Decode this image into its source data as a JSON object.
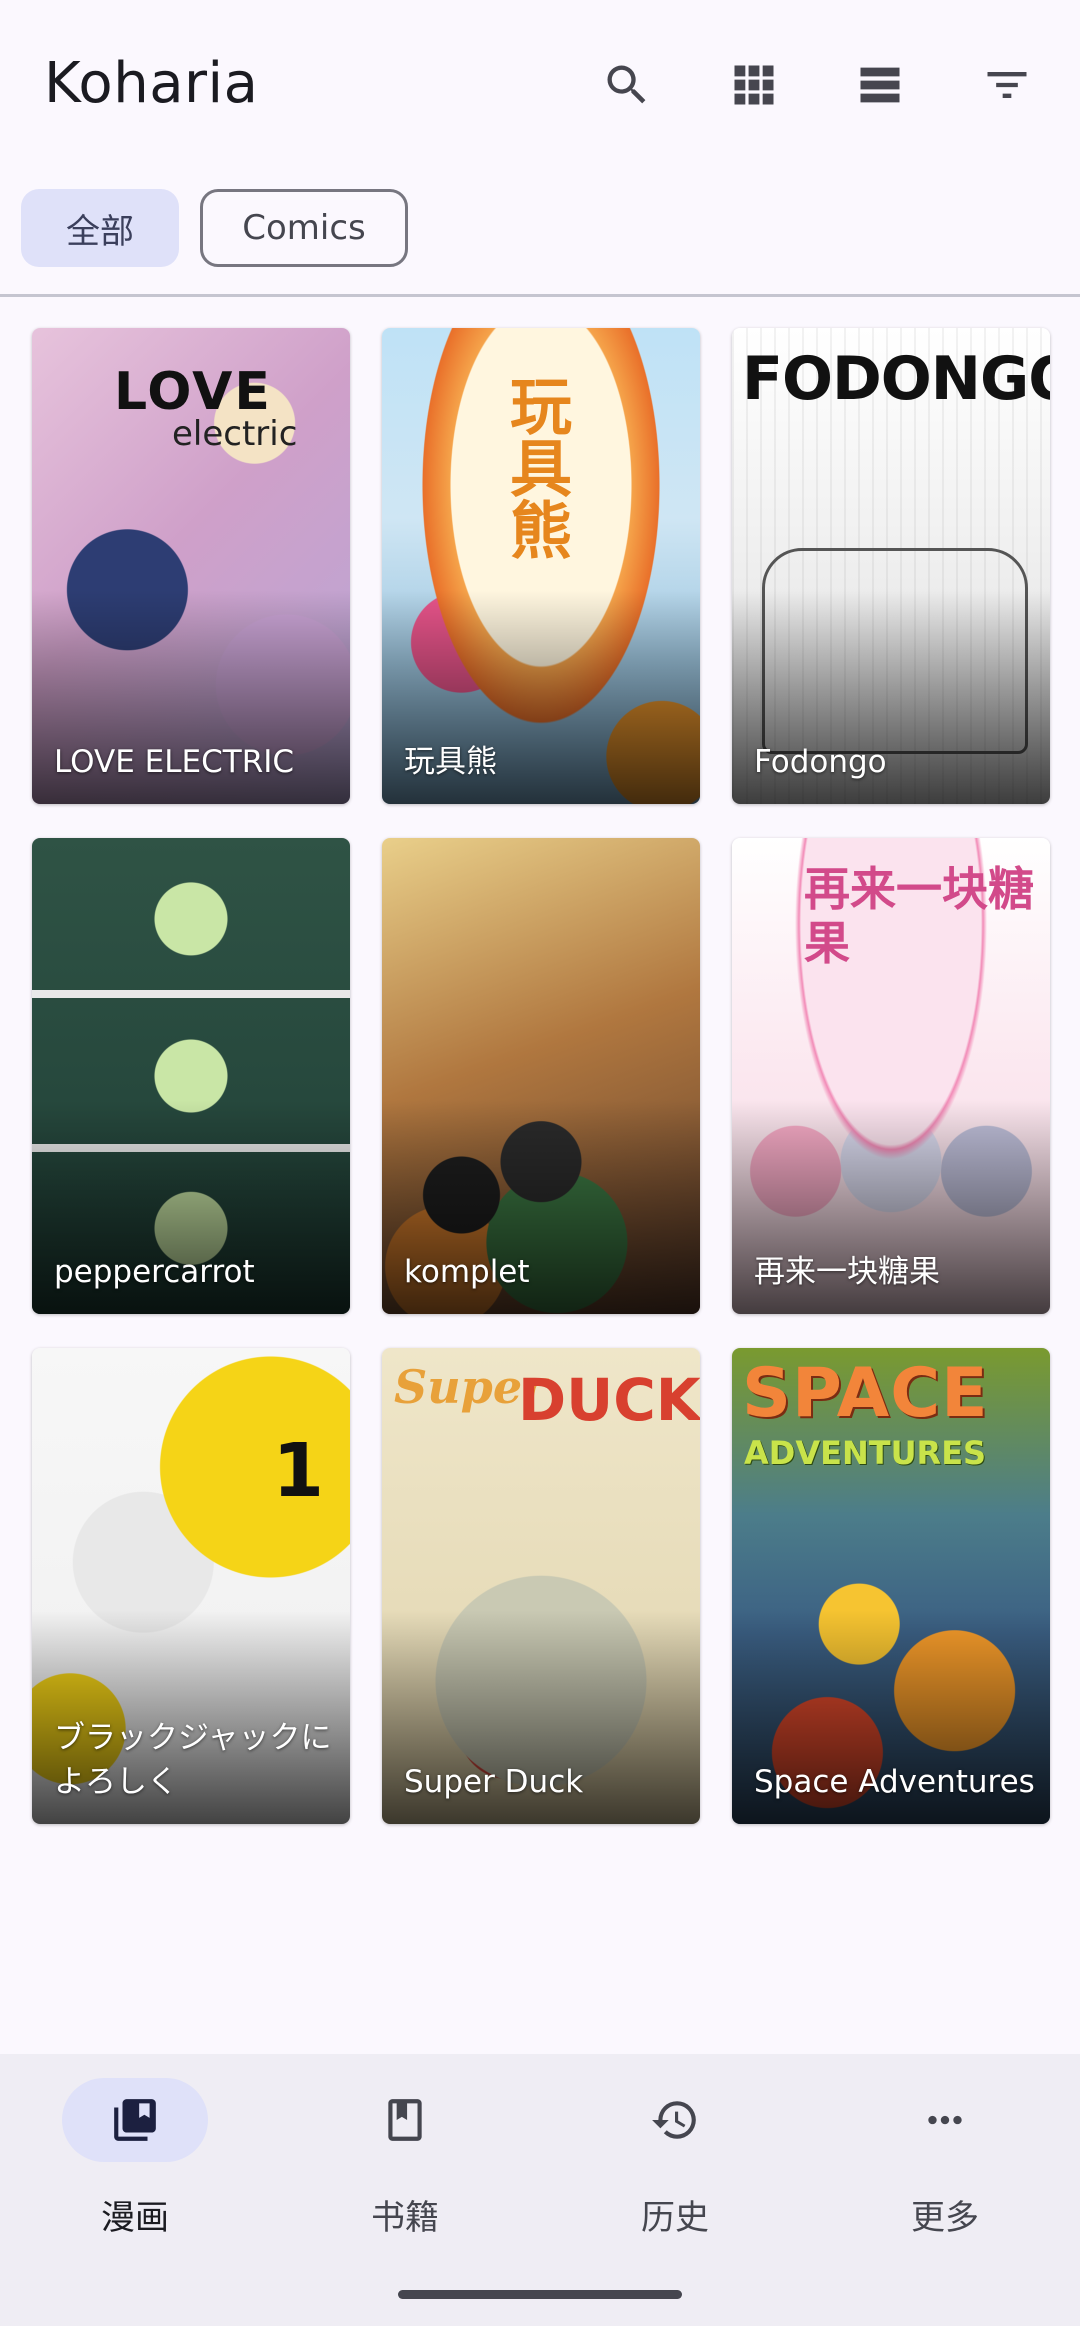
{
  "app": {
    "title": "Koharia"
  },
  "toolbar": {
    "actions": [
      {
        "icon": "search-icon"
      },
      {
        "icon": "grid-view-icon"
      },
      {
        "icon": "list-view-icon"
      },
      {
        "icon": "filter-icon"
      }
    ]
  },
  "filters": {
    "chips": [
      {
        "label": "全部",
        "selected": true
      },
      {
        "label": "Comics",
        "selected": false
      }
    ]
  },
  "library": {
    "items": [
      {
        "title": "LOVE ELECTRIC",
        "cover_text_1": "LOVE",
        "cover_text_2": "electric"
      },
      {
        "title": "玩具熊",
        "cover_text_1": "玩具熊"
      },
      {
        "title": "Fodongo",
        "cover_text_1": "FODONGO"
      },
      {
        "title": "peppercarrot"
      },
      {
        "title": "komplet"
      },
      {
        "title": "再来一块糖果",
        "cover_text_1": "再来一块糖果"
      },
      {
        "title": "ブラックジャックによろしく",
        "cover_text_1": "1",
        "cover_text_2": "ブラックジャックによろしく"
      },
      {
        "title": "Super Duck",
        "cover_text_1": "Super",
        "cover_text_2": "DUCK"
      },
      {
        "title": "Space Adventures",
        "cover_text_1": "SPACE",
        "cover_text_2": "ADVENTURES"
      }
    ]
  },
  "nav": {
    "items": [
      {
        "label": "漫画",
        "icon": "comics-library-icon",
        "active": true
      },
      {
        "label": "书籍",
        "icon": "book-icon",
        "active": false
      },
      {
        "label": "历史",
        "icon": "history-icon",
        "active": false
      },
      {
        "label": "更多",
        "icon": "more-horizontal-icon",
        "active": false
      }
    ]
  },
  "colors": {
    "background": "#fbf8fe",
    "chip_selected": "#dfe1f9",
    "nav_background": "#efedf4",
    "nav_active_pill": "#dfe1f9"
  }
}
